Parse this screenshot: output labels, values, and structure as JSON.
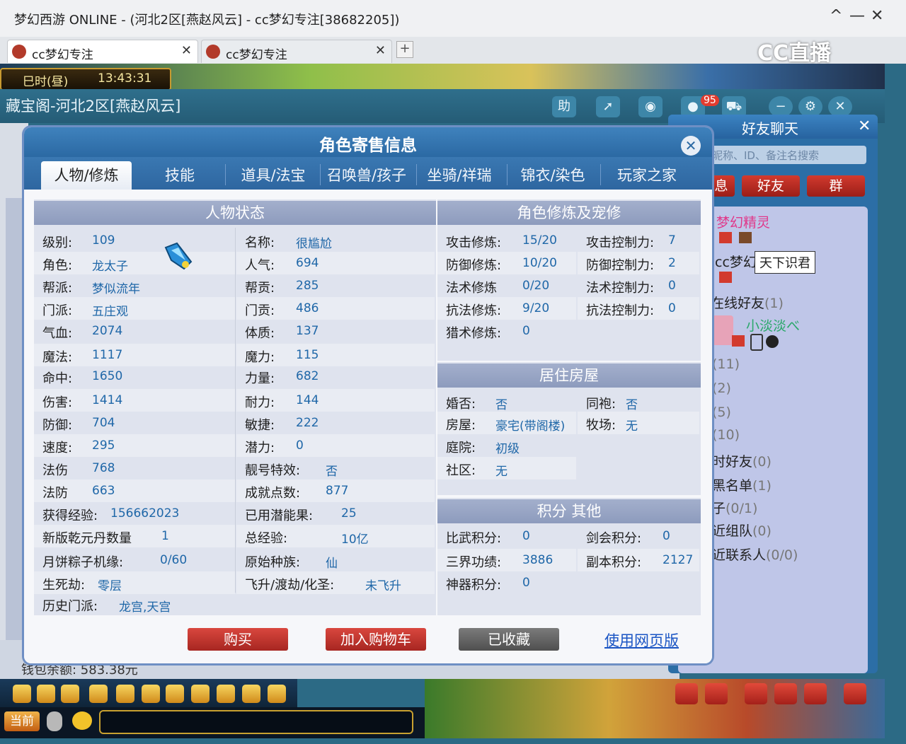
{
  "window": {
    "title": "梦幻西游 ONLINE - (河北2区[燕赵风云] - cc梦幻专注[38682205])",
    "min": "—",
    "close": "✕",
    "expand": "^"
  },
  "browser_tabs": [
    {
      "label": "cc梦幻专注"
    },
    {
      "label": "cc梦幻专注"
    }
  ],
  "tab_close": "✕",
  "new_tab": "+",
  "watermark": "CC直播",
  "game_clock": {
    "period": "巳时(昼)",
    "time": "13:43:31"
  },
  "cbg": {
    "title": "藏宝阁-河北2区[燕赵风云]",
    "help": "助",
    "msg_badge": "95"
  },
  "modal": {
    "title": "角色寄售信息",
    "close": "✕",
    "tabs": [
      "人物/修炼",
      "技能",
      "道具/法宝",
      "召唤兽/孩子",
      "坐骑/祥瑞",
      "锦衣/染色",
      "玩家之家"
    ],
    "status_title": "人物状态",
    "status_left": [
      {
        "label": "级别:",
        "value": "109"
      },
      {
        "label": "角色:",
        "value": "龙太子"
      },
      {
        "label": "帮派:",
        "value": "梦似流年"
      },
      {
        "label": "门派:",
        "value": "五庄观"
      },
      {
        "label": "气血:",
        "value": "2074"
      },
      {
        "label": "魔法:",
        "value": "1117"
      },
      {
        "label": "命中:",
        "value": "1650"
      },
      {
        "label": "伤害:",
        "value": "1414"
      },
      {
        "label": "防御:",
        "value": "704"
      },
      {
        "label": "速度:",
        "value": "295"
      },
      {
        "label": "法伤",
        "value": "768"
      },
      {
        "label": "法防",
        "value": "663"
      },
      {
        "label": "获得经验:",
        "value": "156662023"
      },
      {
        "label": "新版乾元丹数量",
        "value": "1"
      },
      {
        "label": "月饼粽子机缘:",
        "value": "0/60"
      },
      {
        "label": "生死劫:",
        "value": "零层"
      },
      {
        "label": "历史门派:",
        "value": "龙宫,天宫"
      }
    ],
    "status_right": [
      {
        "label": "名称:",
        "value": "很尴尬"
      },
      {
        "label": "人气:",
        "value": "694"
      },
      {
        "label": "帮贡:",
        "value": "285"
      },
      {
        "label": "门贡:",
        "value": "486"
      },
      {
        "label": "体质:",
        "value": "137"
      },
      {
        "label": "魔力:",
        "value": "115"
      },
      {
        "label": "力量:",
        "value": "682"
      },
      {
        "label": "耐力:",
        "value": "144"
      },
      {
        "label": "敏捷:",
        "value": "222"
      },
      {
        "label": "潜力:",
        "value": "0"
      },
      {
        "label": "靓号特效:",
        "value": "否"
      },
      {
        "label": "成就点数:",
        "value": "877"
      },
      {
        "label": "已用潜能果:",
        "value": "25"
      },
      {
        "label": "总经验:",
        "value": "10亿"
      },
      {
        "label": "原始种族:",
        "value": "仙"
      },
      {
        "label": "飞升/渡劫/化圣:",
        "value": "未飞升"
      }
    ],
    "cult_title": "角色修炼及宠修",
    "cult_left": [
      {
        "label": "攻击修炼:",
        "value": "15/20"
      },
      {
        "label": "防御修炼:",
        "value": "10/20"
      },
      {
        "label": "法术修炼",
        "value": "0/20"
      },
      {
        "label": "抗法修炼:",
        "value": "9/20"
      },
      {
        "label": "猎术修炼:",
        "value": "0"
      }
    ],
    "cult_right": [
      {
        "label": "攻击控制力:",
        "value": "7"
      },
      {
        "label": "防御控制力:",
        "value": "2"
      },
      {
        "label": "法术控制力:",
        "value": "0"
      },
      {
        "label": "抗法控制力:",
        "value": "0"
      }
    ],
    "house_title": "居住房屋",
    "house_left": [
      {
        "label": "婚否:",
        "value": "否"
      },
      {
        "label": "房屋:",
        "value": "豪宅(带阁楼)"
      },
      {
        "label": "庭院:",
        "value": "初级"
      },
      {
        "label": "社区:",
        "value": "无"
      }
    ],
    "house_right": [
      {
        "label": "同袍:",
        "value": "否"
      },
      {
        "label": "牧场:",
        "value": "无"
      }
    ],
    "score_title": "积分 其他",
    "score_left": [
      {
        "label": "比武积分:",
        "value": "0"
      },
      {
        "label": "三界功绩:",
        "value": "3886"
      },
      {
        "label": "神器积分:",
        "value": "0"
      }
    ],
    "score_right": [
      {
        "label": "剑会积分:",
        "value": "0"
      },
      {
        "label": "副本积分:",
        "value": "2127"
      }
    ],
    "buttons": {
      "buy": "购买",
      "cart": "加入购物车",
      "fav": "已收藏",
      "web": "使用网页版"
    }
  },
  "friends": {
    "title": "好友聊天",
    "close": "✕",
    "search_placeholder": "昵称、ID、备注名搜索",
    "tabs": [
      "息",
      "好友",
      "群"
    ],
    "jingling": "梦幻精灵",
    "ccname": "cc梦幻",
    "tooltip": "天下识君",
    "online_label": "在线好友",
    "online_count": "(1)",
    "friend_name": "小淡淡べ",
    "groups": [
      {
        "label": "",
        "count": "(11)"
      },
      {
        "label": "",
        "count": "(2)"
      },
      {
        "label": "",
        "count": "(5)"
      },
      {
        "label": "",
        "count": "(10)"
      },
      {
        "label": "时好友",
        "count": "(0)"
      },
      {
        "label": "黑名单",
        "count": "(1)"
      },
      {
        "label": "子",
        "count": "(0/1)"
      },
      {
        "label": "近组队",
        "count": "(0)"
      },
      {
        "label": "近联系人",
        "count": "(0/0)"
      }
    ]
  },
  "bottom": {
    "current": "当前",
    "money": "钱包余额: 583.38元"
  }
}
